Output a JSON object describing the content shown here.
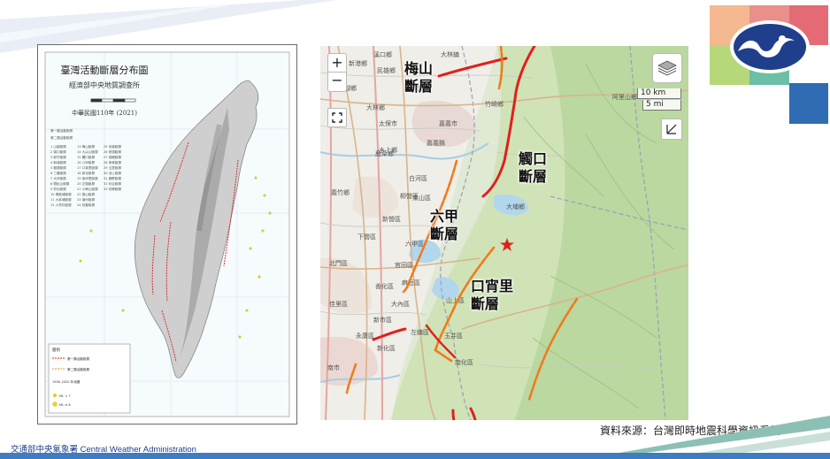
{
  "colors": {
    "band_blue": "#3d7dc3",
    "band_green": "#8cc0b4",
    "logo_peach": "#f4b990",
    "logo_pink": "#e46b75",
    "logo_green": "#b6d87a",
    "logo_teal": "#6cbfa6",
    "logo_blue": "#2f6cb3",
    "fault_red": "#e0201c",
    "fault_orange": "#f07a1b"
  },
  "left_map": {
    "title": "臺灣活動斷層分布圖",
    "subtitle": "經濟部中央地質調查所",
    "date": "中華民國110年 (2021)"
  },
  "web_map": {
    "controls": {
      "zoom_in": "+",
      "zoom_out": "−",
      "fullscreen_icon": "fullscreen-icon",
      "layers_icon": "layers-icon",
      "measure_icon": "measure-icon"
    },
    "scale": {
      "km": "10 km",
      "mi": "5 mi"
    },
    "labels": {
      "meishan": [
        "梅山",
        "斷層"
      ],
      "chukou": [
        "觸口",
        "斷層"
      ],
      "liuchia": [
        "六甲",
        "斷層"
      ],
      "kouhsiaoli": [
        "口宵里",
        "斷層"
      ]
    },
    "epicenter_icon": "star-icon"
  },
  "source": "資料來源：台灣即時地震科學資訊系統",
  "footer": "交通部中央氣象署 Central Weather Administration"
}
